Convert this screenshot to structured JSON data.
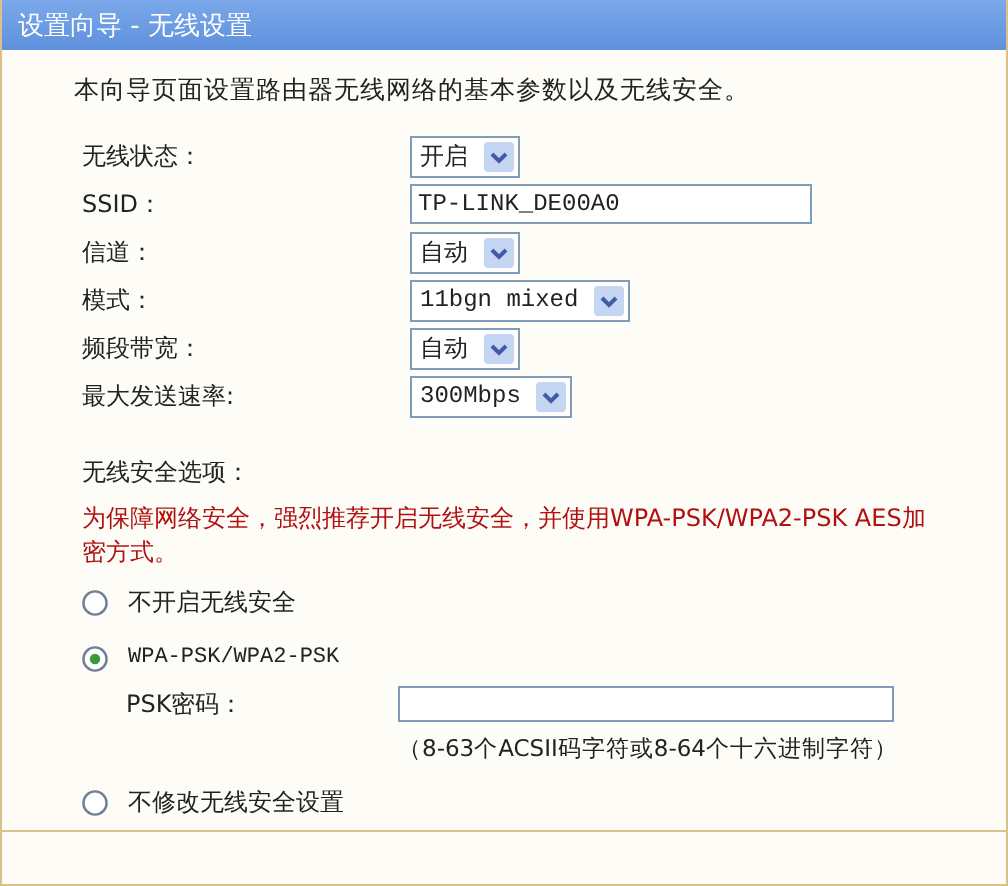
{
  "window": {
    "title": "设置向导 - 无线设置"
  },
  "intro": "本向导页面设置路由器无线网络的基本参数以及无线安全。",
  "fields": [
    {
      "label": "无线状态：",
      "kind": "select",
      "value": "开启"
    },
    {
      "label": "SSID：",
      "kind": "text",
      "value": "TP-LINK_DE00A0"
    },
    {
      "label": "信道：",
      "kind": "select",
      "value": "自动"
    },
    {
      "label": "模式：",
      "kind": "select",
      "value": "11bgn mixed"
    },
    {
      "label": "频段带宽：",
      "kind": "select",
      "value": "自动"
    },
    {
      "label": "最大发送速率:",
      "kind": "select",
      "value": "300Mbps"
    }
  ],
  "security": {
    "heading": "无线安全选项：",
    "warning": "为保障网络安全，强烈推荐开启无线安全，并使用WPA-PSK/WPA2-PSK AES加密方式。",
    "options": [
      {
        "label": "不开启无线安全",
        "selected": false
      },
      {
        "label": "WPA-PSK/WPA2-PSK",
        "selected": true,
        "psk": {
          "label": "PSK密码：",
          "hint": "（8-63个ACSII码字符或8-64个十六进制字符）"
        }
      },
      {
        "label": "不修改无线安全设置",
        "selected": false
      }
    ]
  }
}
